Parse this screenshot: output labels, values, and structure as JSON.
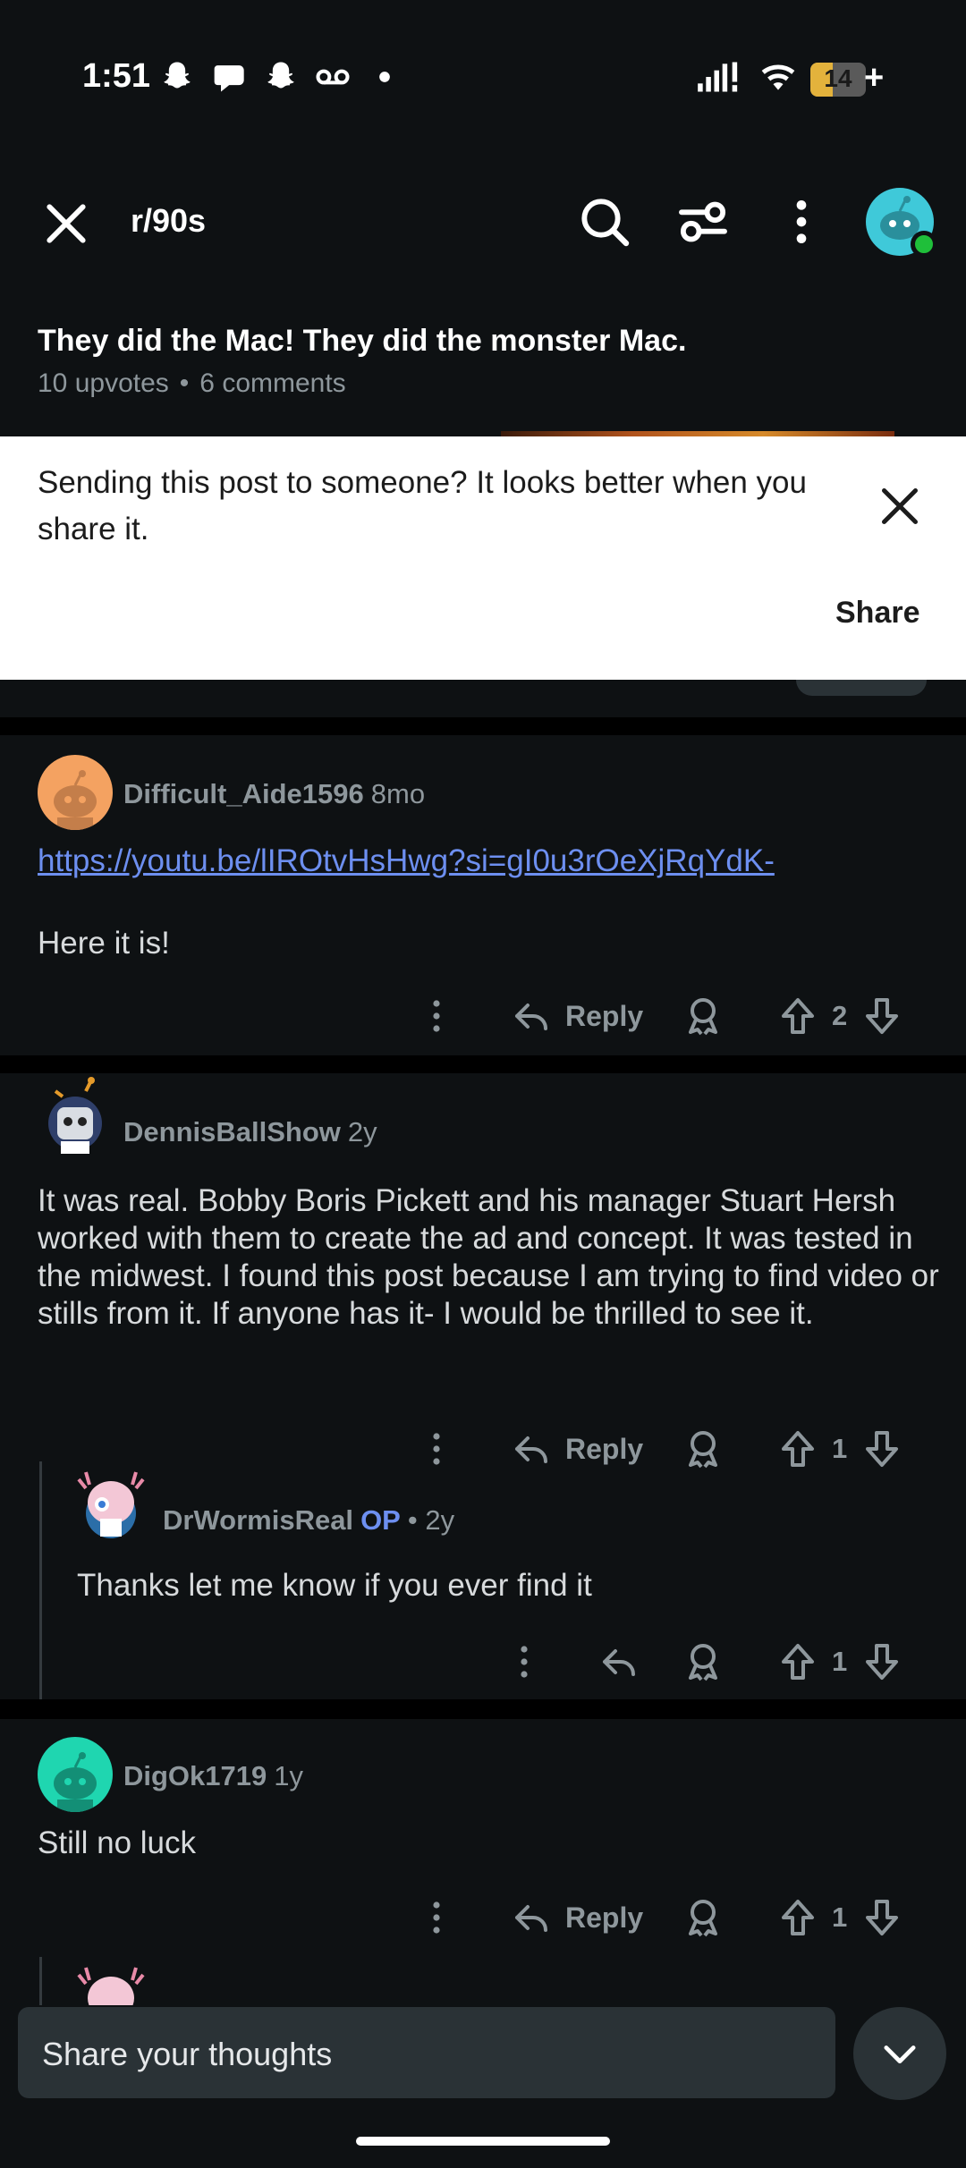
{
  "status_bar": {
    "time": "1:51",
    "battery_level": "14",
    "battery_fraction": 0.4,
    "notification_icons": [
      "snapchat-icon",
      "chat-bubble-icon",
      "snapchat-icon",
      "voicemail-icon",
      "dot-icon"
    ],
    "system_icons": [
      "signal-icon",
      "wifi-icon",
      "battery-icon"
    ]
  },
  "top_bar": {
    "subreddit": "r/90s",
    "icons": [
      "close-icon",
      "search-icon",
      "filter-icon",
      "more-vertical-icon",
      "avatar"
    ]
  },
  "post": {
    "title": "They did the Mac! They did the monster Mac.",
    "upvotes": "10 upvotes",
    "comments": "6 comments"
  },
  "share_banner": {
    "text": "Sending this post to someone? It looks better when you share it.",
    "share_label": "Share"
  },
  "comments": [
    {
      "user": "Difficult_Aide1596",
      "time": "8mo",
      "link": "https://youtu.be/lIROtvHsHwg?si=gI0u3rOeXjRqYdK-",
      "body": "Here it is!",
      "reply_label": "Reply",
      "votes": "2"
    },
    {
      "user": "DennisBallShow",
      "time": "2y",
      "body": "It was real. Bobby Boris Pickett and his manager Stuart Hersh worked with them to create the ad and concept. It was tested in the midwest. I found this post because I am trying to find video or stills from it. If anyone has it- I would be thrilled to see it.",
      "reply_label": "Reply",
      "votes": "1"
    },
    {
      "user": "DrWormisReal",
      "op_badge": "OP",
      "time": "• 2y",
      "body": "Thanks let me know if you ever find it",
      "votes": "1"
    },
    {
      "user": "DigOk1719",
      "time": "1y",
      "body": "Still no luck",
      "reply_label": "Reply",
      "votes": "1"
    }
  ],
  "composer": {
    "placeholder": "Share your thoughts"
  },
  "colors": {
    "background": "#0e1113",
    "link": "#6d8ff0",
    "muted": "#8e979c",
    "online": "#1fbf3a"
  }
}
